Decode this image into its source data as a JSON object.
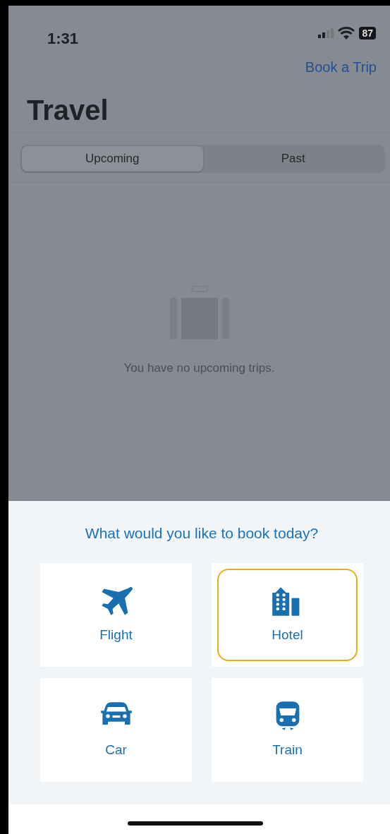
{
  "status_bar": {
    "time": "1:31",
    "battery": "87"
  },
  "header": {
    "action": "Book a Trip",
    "title": "Travel"
  },
  "tabs": [
    {
      "label": "Upcoming",
      "selected": true
    },
    {
      "label": "Past",
      "selected": false
    }
  ],
  "empty_state": {
    "message": "You have no upcoming trips."
  },
  "booking_sheet": {
    "heading": "What would you like to book today?",
    "options": [
      {
        "kind": "flight",
        "label": "Flight",
        "selected": false
      },
      {
        "kind": "hotel",
        "label": "Hotel",
        "selected": true
      },
      {
        "kind": "car",
        "label": "Car",
        "selected": false
      },
      {
        "kind": "train",
        "label": "Train",
        "selected": false
      }
    ]
  }
}
